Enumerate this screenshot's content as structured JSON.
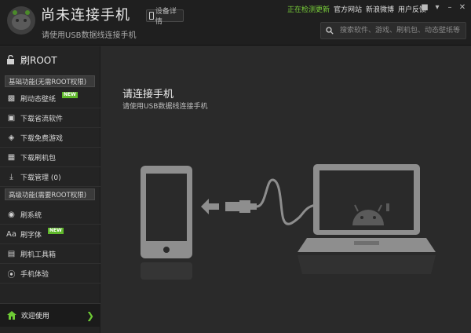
{
  "header": {
    "title": "尚未连接手机",
    "subtitle": "请使用USB数据线连接手机",
    "device_button": "设备详情",
    "status_text": "正在检测更新",
    "links": [
      "官方网站",
      "新浪微博",
      "用户反馈"
    ],
    "search_placeholder": "搜索软件、游戏、刷机包、动态壁纸等"
  },
  "sidebar": {
    "header_label": "刷ROOT",
    "section_basic": "基础功能(无需ROOT权限)",
    "basic_items": [
      {
        "label": "刷动态壁纸",
        "icon": "wallpaper-icon",
        "badge": "NEW"
      },
      {
        "label": "下载省流软件",
        "icon": "box-icon"
      },
      {
        "label": "下载免费游戏",
        "icon": "gamepad-icon"
      },
      {
        "label": "下载刷机包",
        "icon": "package-download-icon"
      },
      {
        "label": "下载管理 (0)",
        "icon": "download-icon"
      }
    ],
    "section_advanced": "高级功能(需要ROOT权限)",
    "advanced_items": [
      {
        "label": "刷系统",
        "icon": "system-icon"
      },
      {
        "label": "刷字体",
        "icon": "font-icon",
        "badge": "NEW",
        "icon_text": "Aa"
      },
      {
        "label": "刷机工具箱",
        "icon": "toolbox-icon"
      },
      {
        "label": "手机体验",
        "icon": "upload-circle-icon"
      }
    ],
    "welcome_label": "欢迎使用"
  },
  "main": {
    "title": "请连接手机",
    "subtitle": "请使用USB数据线连接手机"
  },
  "colors": {
    "accent_green": "#6ecb35",
    "background": "#2a2a2a",
    "sidebar": "#242424",
    "illustration": "#8e8e8e"
  }
}
